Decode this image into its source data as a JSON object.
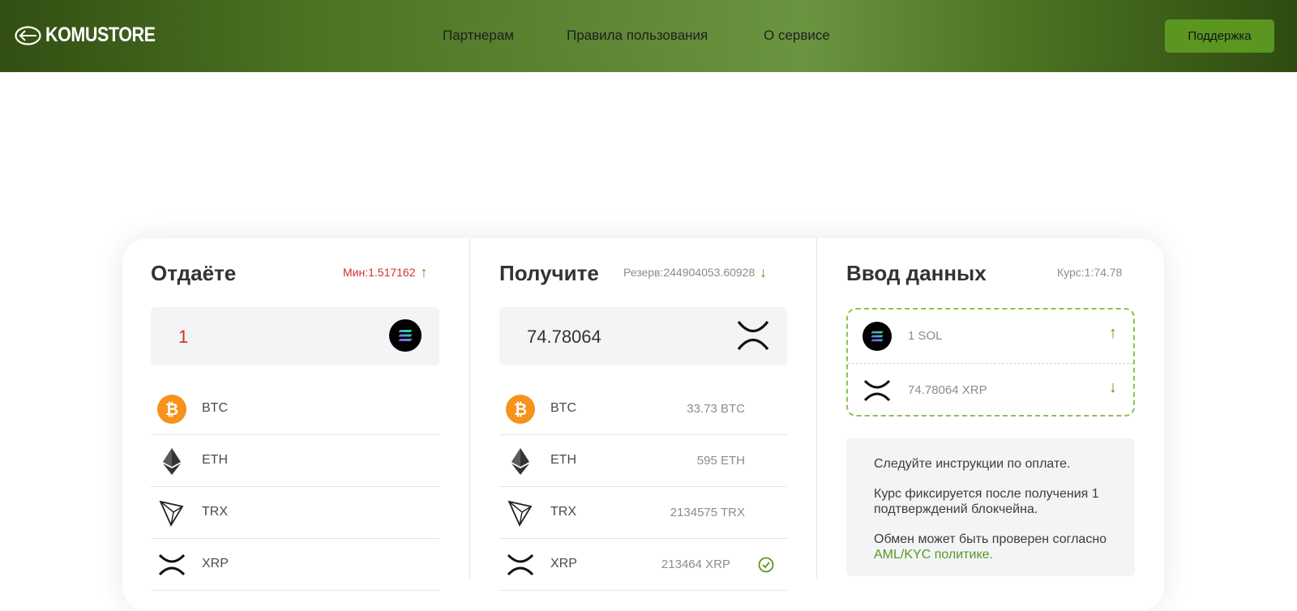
{
  "header": {
    "brand": "KOMUSTORE",
    "nav": [
      "Партнерам",
      "Правила пользования",
      "О сервисе"
    ],
    "support_label": "Поддержка"
  },
  "give": {
    "title": "Отдаёте",
    "min_label": "Мин:1.517162",
    "arrow": "↑",
    "amount": "1",
    "amount_icon": "solana-icon",
    "coins": [
      {
        "symbol": "BTC",
        "icon": "bitcoin-icon"
      },
      {
        "symbol": "ETH",
        "icon": "ethereum-icon"
      },
      {
        "symbol": "TRX",
        "icon": "tron-icon"
      },
      {
        "symbol": "XRP",
        "icon": "xrp-icon"
      }
    ]
  },
  "receive": {
    "title": "Получите",
    "reserve_label": "Резерв:244904053.60928",
    "arrow": "↓",
    "amount": "74.78064",
    "amount_icon": "xrp-icon",
    "coins": [
      {
        "symbol": "BTC",
        "reserve": "33.73 BTC",
        "icon": "bitcoin-icon"
      },
      {
        "symbol": "ETH",
        "reserve": "595 ETH",
        "icon": "ethereum-icon"
      },
      {
        "symbol": "TRX",
        "reserve": "2134575 TRX",
        "icon": "tron-icon"
      },
      {
        "symbol": "XRP",
        "reserve": "213464 XRP",
        "icon": "xrp-icon"
      }
    ]
  },
  "data_entry": {
    "title": "Ввод данных",
    "rate_label": "Курс:1:74.78",
    "give_line": "1 SOL",
    "give_arrow": "↑",
    "receive_line": "74.78064 XRP",
    "receive_arrow": "↓",
    "info_1": "Следуйте инструкции по оплате.",
    "info_2": "Курс фиксируется после получения 1 подтверждений блокчейна.",
    "info_3_prefix": "Обмен может быть проверен согласно ",
    "info_3_link": "AML/KYC политике."
  },
  "colors": {
    "accent": "#5a9620",
    "min_red": "#d32f2f",
    "bitcoin": "#f7931a"
  }
}
